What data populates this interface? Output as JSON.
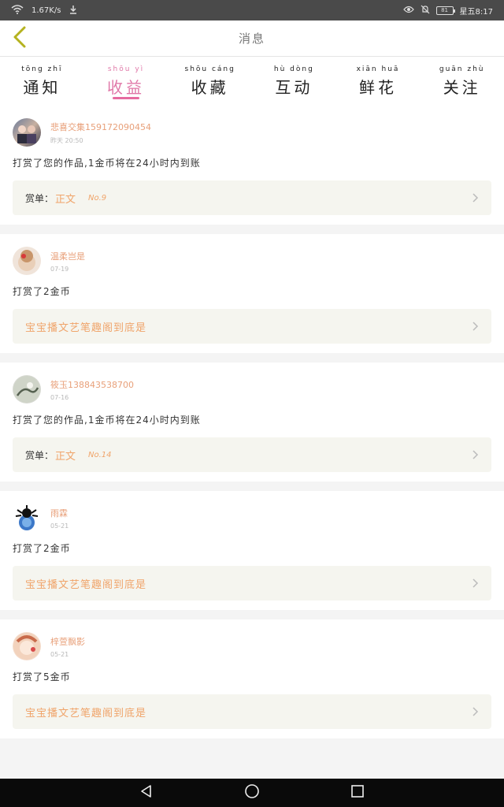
{
  "status_bar": {
    "net_speed": "1.67K/s",
    "time": "星五8:17"
  },
  "header": {
    "title": "消息"
  },
  "tabs": [
    {
      "pinyin": "tōng zhī",
      "label": "通知",
      "active": false
    },
    {
      "pinyin": "shōu yì",
      "label": "收益",
      "active": true
    },
    {
      "pinyin": "shōu cáng",
      "label": "收藏",
      "active": false
    },
    {
      "pinyin": "hù dòng",
      "label": "互动",
      "active": false
    },
    {
      "pinyin": "xiān huā",
      "label": "鲜花",
      "active": false
    },
    {
      "pinyin": "guān zhù",
      "label": "关注",
      "active": false
    }
  ],
  "messages": [
    {
      "username": "悲喜交集159172090454",
      "time": "昨天 20:50",
      "text": "打赏了您的作品,1金币将在24小时内到账",
      "detail_label": "赏单：",
      "detail_work": "正文",
      "detail_no": "No.9"
    },
    {
      "username": "温柔岂是",
      "time": "07-19",
      "text": "打赏了2金币",
      "detail_text": "宝宝播文艺笔趣阁到底是"
    },
    {
      "username": "筱玉138843538700",
      "time": "07-16",
      "text": "打赏了您的作品,1金币将在24小时内到账",
      "detail_label": "赏单：",
      "detail_work": "正文",
      "detail_no": "No.14"
    },
    {
      "username": "雨霖",
      "time": "05-21",
      "text": "打赏了2金币",
      "detail_text": "宝宝播文艺笔趣阁到底是"
    },
    {
      "username": "梓萱飘影",
      "time": "05-21",
      "text": "打赏了5金币",
      "detail_text": "宝宝播文艺笔趣阁到底是"
    }
  ],
  "colors": {
    "accent_pink": "#e66aa0",
    "accent_orange": "#f0a46a",
    "back_arrow": "#b5b21f"
  }
}
